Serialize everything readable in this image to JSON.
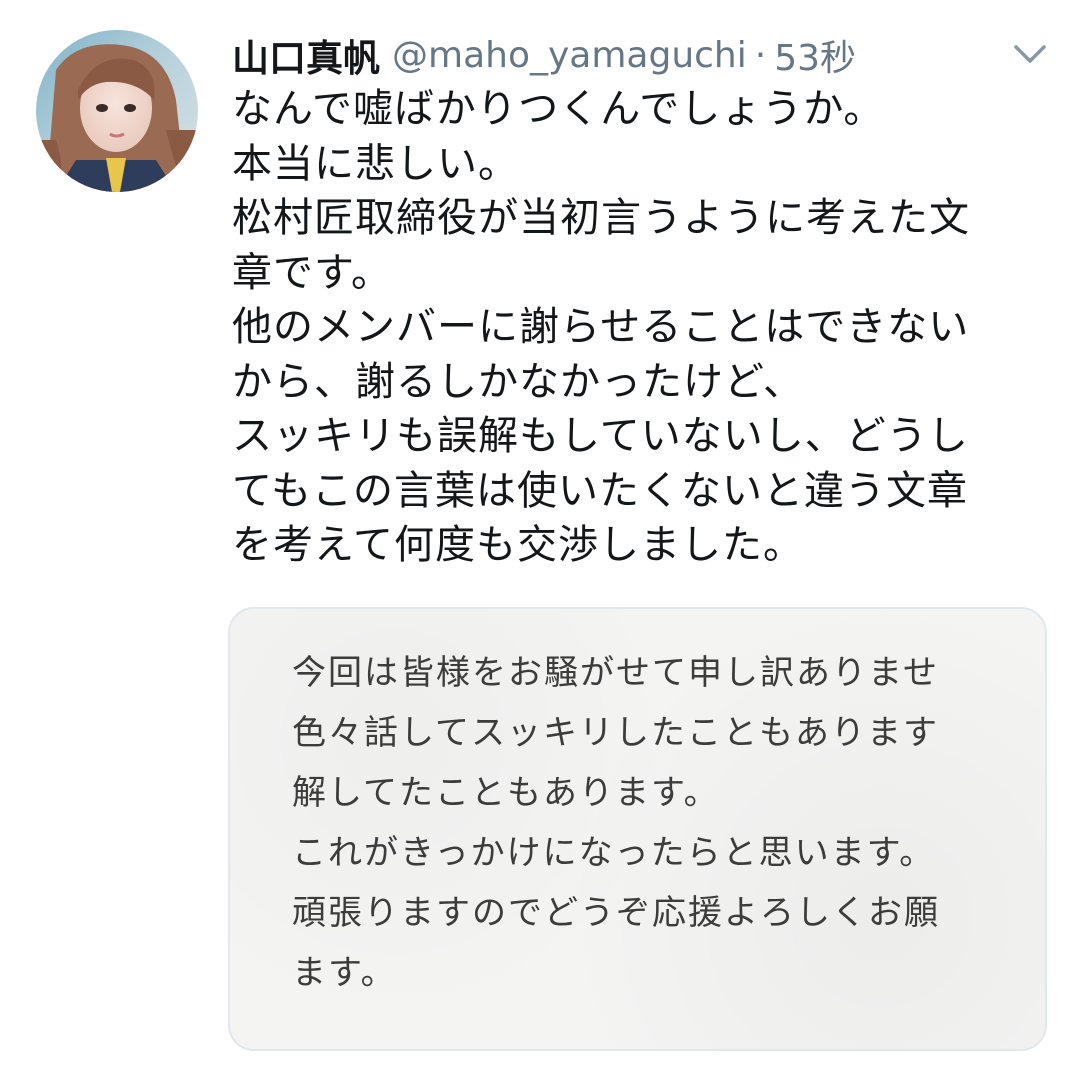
{
  "tweet": {
    "avatar_icon": "user-avatar-photo",
    "display_name": "山口真帆",
    "handle": "@maho_yamaguchi",
    "separator": "·",
    "timestamp": "53秒",
    "caret_icon": "chevron-down-icon",
    "text_lines": [
      "なんで嘘ばかりつくんでしょうか。",
      "本当に悲しい。",
      "松村匠取締役が当初言うように考えた文",
      "章です。",
      "他のメンバーに謝らせることはできない",
      "から、謝るしかなかったけど、",
      "スッキリも誤解もしていないし、どうし",
      "てもこの言葉は使いたくないと違う文章",
      "を考えて何度も交渉しました。"
    ],
    "attached_image": {
      "text_lines": [
        "今回は皆様をお騒がせて申し訳ありませ",
        "色々話してスッキリしたこともあります",
        "解してたこともあります。",
        "これがきっかけになったらと思います。",
        "頑張りますのでどうぞ応援よろしくお願",
        "ます。"
      ]
    },
    "colors": {
      "primary_text": "#14171a",
      "secondary_text": "#657786",
      "card_border": "#e1e8ed",
      "card_background": "#f4f4f3",
      "card_text": "#3c3c3c"
    }
  }
}
